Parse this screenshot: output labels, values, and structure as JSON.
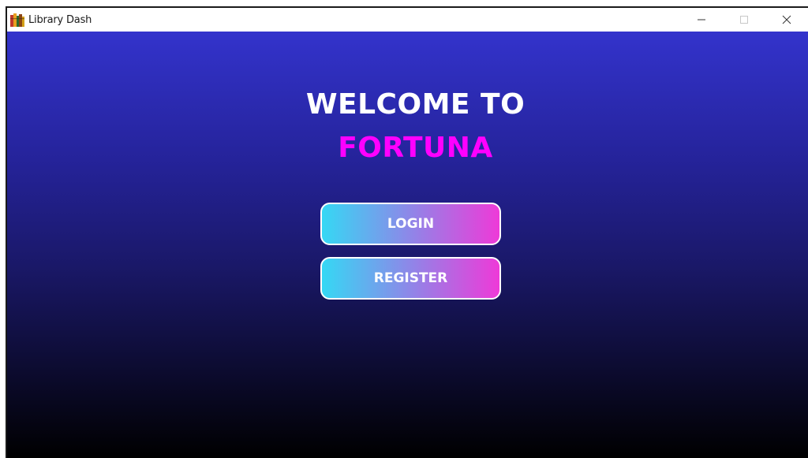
{
  "window": {
    "title": "Library Dash",
    "controls": [
      "minimize-icon",
      "maximize-icon",
      "close-icon"
    ]
  },
  "welcome": {
    "line1": "WELCOME TO",
    "line2": "FORTUNA"
  },
  "buttons": {
    "login": "LOGIN",
    "register": "REGISTER"
  },
  "colors": {
    "accent": "#ff00ff",
    "gradient_top": "#3333cc",
    "gradient_bottom": "#000000",
    "button_left": "#35d8f4",
    "button_right": "#ee3ad8"
  }
}
